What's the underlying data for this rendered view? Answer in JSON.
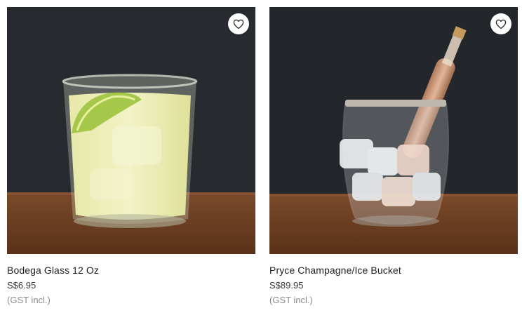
{
  "products": [
    {
      "name": "Bodega Glass 12 Oz",
      "price": "S$6.95",
      "tax_note": "(GST incl.)",
      "favorite_icon": "heart-outline-icon"
    },
    {
      "name": "Pryce Champagne/Ice Bucket",
      "price": "S$89.95",
      "tax_note": "(GST incl.)",
      "favorite_icon": "heart-outline-icon"
    }
  ],
  "colors": {
    "backdrop": "#262a2f",
    "table_wood": "#6e4327",
    "favorite_button_bg": "#ffffff",
    "muted_text": "#8a8a8a"
  }
}
